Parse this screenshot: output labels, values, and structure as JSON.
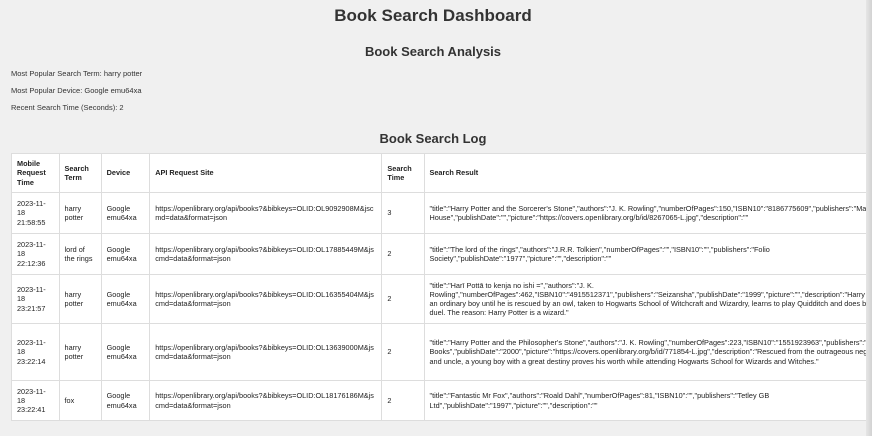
{
  "page": {
    "title": "Book Search Dashboard"
  },
  "analysis": {
    "title": "Book Search Analysis",
    "popular_term": "Most Popular Search Term: harry potter",
    "popular_device": "Most Popular Device: Google emu64xa",
    "recent_time": "Recent Search Time (Seconds): 2"
  },
  "log": {
    "title": "Book Search Log",
    "headers": {
      "time": "Mobile Request Time",
      "term": "Search Term",
      "device": "Device",
      "api": "API Request Site",
      "search_time": "Search Time",
      "result": "Search Result"
    },
    "rows": [
      {
        "time": "2023-11-18 21:58:55",
        "term": "harry potter",
        "device": "Google emu64xa",
        "api": "https://openlibrary.org/api/books?&bibkeys=OLID:OL9092908M&jscmd=data&format=json",
        "search_time": "3",
        "result": "\"title\":\"Harry Potter and the Sorcerer's Stone\",\"authors\":\"J. K. Rowling\",\"numberOfPages\":150,\"ISBN10\":\"8186775609\",\"publishers\":\"Manjul Publishing House\",\"publishDate\":\"\",\"picture\":\"https://covers.openlibrary.org/b/id/8267065-L.jpg\",\"description\":\"\""
      },
      {
        "time": "2023-11-18 22:12:36",
        "term": "lord of the rings",
        "device": "Google emu64xa",
        "api": "https://openlibrary.org/api/books?&bibkeys=OLID:OL17885449M&jscmd=data&format=json",
        "search_time": "2",
        "result": "\"title\":\"The lord of the rings\",\"authors\":\"J.R.R. Tolkien\",\"numberOfPages\":\"\",\"ISBN10\":\"\",\"publishers\":\"Folio Society\",\"publishDate\":\"1977\",\"picture\":\"\",\"description\":\"\""
      },
      {
        "time": "2023-11-18 23:21:57",
        "term": "harry potter",
        "device": "Google emu64xa",
        "api": "https://openlibrary.org/api/books?&bibkeys=OLID:OL16355404M&jscmd=data&format=json",
        "search_time": "2",
        "result": "\"title\":\"Harī Pottā to kenja no ishi =\",\"authors\":\"J. K. Rowling\",\"numberOfPages\":462,\"ISBN10\":\"4915512371\",\"publishers\":\"Seizansha\",\"publishDate\":\"1999\",\"picture\":\"\",\"description\":\"Harry Potter thinks he is an ordinary boy until he is rescued by an owl, taken to Hogwarts School of Witchcraft and Wizardry, learns to play Quidditch and does battle in a deadly duel. The reason: Harry Potter is a wizard.\""
      },
      {
        "time": "2023-11-18 23:22:14",
        "term": "harry potter",
        "device": "Google emu64xa",
        "api": "https://openlibrary.org/api/books?&bibkeys=OLID:OL13639000M&jscmd=data&format=json",
        "search_time": "2",
        "result": "\"title\":\"Harry Potter and the Philosopher's Stone\",\"authors\":\"J. K. Rowling\",\"numberOfPages\":223,\"ISBN10\":\"1551923963\",\"publishers\":\"Raincoast Books\",\"publishDate\":\"2000\",\"picture\":\"https://covers.openlibrary.org/b/id/771854-L.jpg\",\"description\":\"Rescued from the outrageous neglect of his aunt and uncle, a young boy with a great destiny proves his worth while attending Hogwarts School for Wizards and Witches.\""
      },
      {
        "time": "2023-11-18 23:22:41",
        "term": "fox",
        "device": "Google emu64xa",
        "api": "https://openlibrary.org/api/books?&bibkeys=OLID:OL18176186M&jscmd=data&format=json",
        "search_time": "2",
        "result": "\"title\":\"Fantastic Mr Fox\",\"authors\":\"Roald Dahl\",\"numberOfPages\":81,\"ISBN10\":\"\",\"publishers\":\"Tetley GB Ltd\",\"publishDate\":\"1997\",\"picture\":\"\",\"description\":\"\""
      }
    ]
  }
}
